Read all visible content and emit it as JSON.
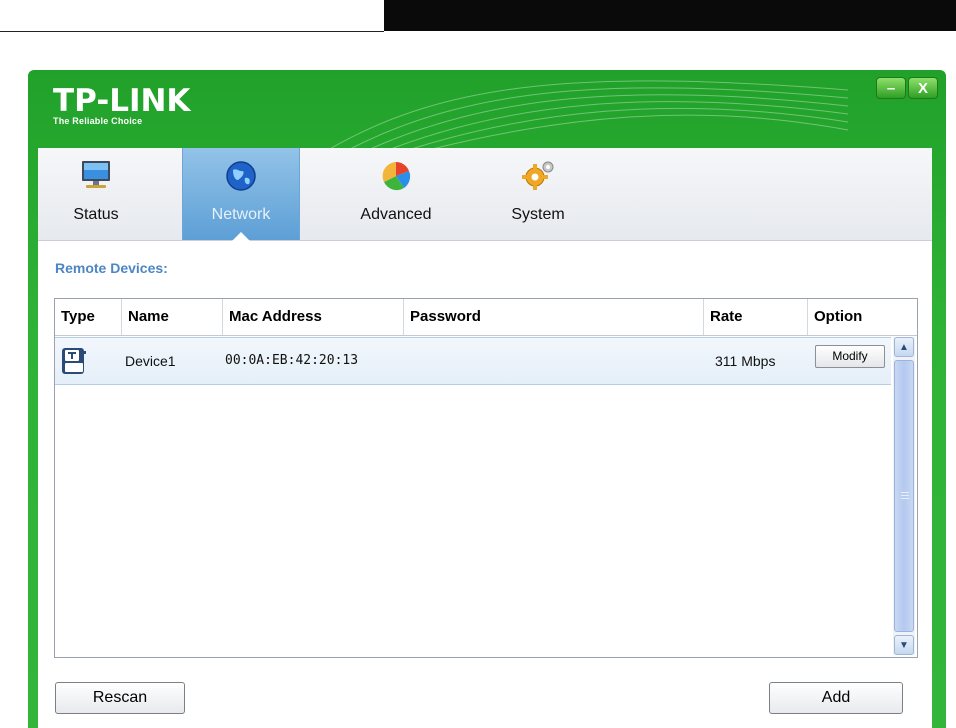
{
  "app": {
    "logo": "TP-LINK",
    "tagline": "The Reliable Choice"
  },
  "window_controls": {
    "minimize": "–",
    "close": "X"
  },
  "tabs": [
    {
      "label": "Status",
      "icon": "monitor-icon",
      "active": false
    },
    {
      "label": "Network",
      "icon": "globe-icon",
      "active": true
    },
    {
      "label": "Advanced",
      "icon": "pie-chart-icon",
      "active": false
    },
    {
      "label": "System",
      "icon": "gear-icon",
      "active": false
    }
  ],
  "section_title": "Remote Devices:",
  "table": {
    "columns": [
      "Type",
      "Name",
      "Mac Address",
      "Password",
      "Rate",
      "Option"
    ],
    "rows": [
      {
        "type_icon": "powerline-device-icon",
        "name": "Device1",
        "mac": "00:0A:EB:42:20:13",
        "password": "",
        "rate": "311 Mbps",
        "option": "Modify"
      }
    ]
  },
  "buttons": {
    "rescan": "Rescan",
    "add": "Add"
  },
  "colors": {
    "brand_green": "#2fb336",
    "active_tab": "#5d9fd6",
    "section_title": "#4e86c4"
  }
}
